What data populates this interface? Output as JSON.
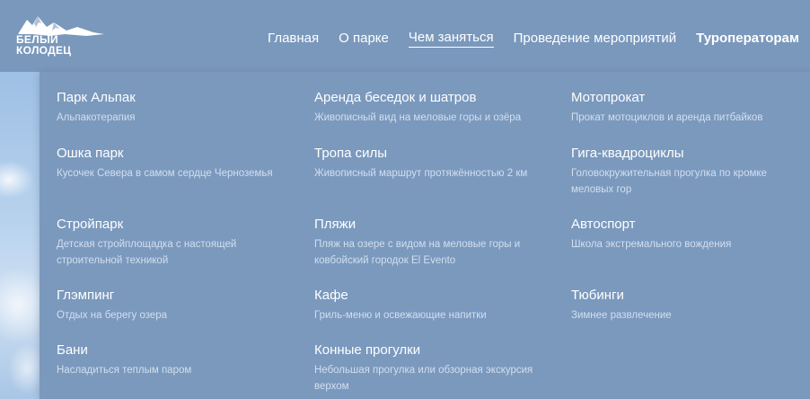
{
  "logo": {
    "line1": "БЕЛЫЙ",
    "line2": "КОЛОДЕЦ"
  },
  "nav": [
    {
      "label": "Главная"
    },
    {
      "label": "О парке"
    },
    {
      "label": "Чем заняться"
    },
    {
      "label": "Проведение мероприятий"
    },
    {
      "label": "Туроператорам"
    }
  ],
  "columns": [
    {
      "items": [
        {
          "title": "Парк Альпак",
          "desc": "Альпакотерапия"
        },
        {
          "title": "Ошка парк",
          "desc": "Кусочек Севера в самом сердце Черноземья"
        },
        {
          "title": "Стройпарк",
          "desc": "Детская стройплощадка с настоящей строительной техникой"
        },
        {
          "title": "Глэмпинг",
          "desc": "Отдых на берегу озера"
        },
        {
          "title": "Бани",
          "desc": "Насладиться теплым паром"
        }
      ]
    },
    {
      "items": [
        {
          "title": "Аренда беседок и шатров",
          "desc": "Живописный вид на меловые горы и озёра"
        },
        {
          "title": "Тропа силы",
          "desc": "Живописный маршрут протяжённостью 2 км"
        },
        {
          "title": "Пляжи",
          "desc": "Пляж на озере с видом на меловые горы и ковбойский городок El Evento"
        },
        {
          "title": "Кафе",
          "desc": "Гриль-меню и освежающие напитки"
        },
        {
          "title": "Конные прогулки",
          "desc": "Небольшая прогулка или обзорная экскурсия верхом"
        }
      ]
    },
    {
      "items": [
        {
          "title": "Мотопрокат",
          "desc": "Прокат мотоциклов и аренда питбайков"
        },
        {
          "title": "Гига-квадроциклы",
          "desc": "Головокружительная прогулка по кромке меловых гор"
        },
        {
          "title": "Автоспорт",
          "desc": "Школа экстремального вождения"
        },
        {
          "title": "Тюбинги",
          "desc": "Зимнее развлечение"
        }
      ]
    }
  ]
}
